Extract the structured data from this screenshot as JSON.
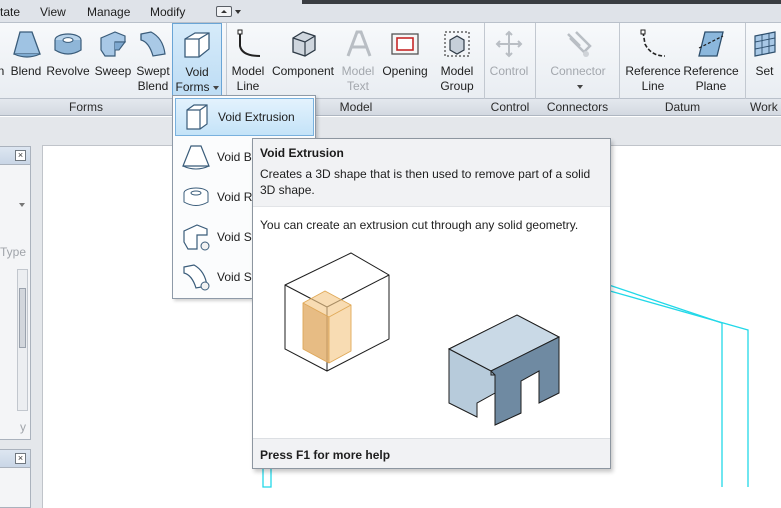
{
  "menubar": {
    "items": [
      "tate",
      "View",
      "Manage",
      "Modify"
    ]
  },
  "ribbon": {
    "buttons": {
      "n": "n",
      "blend": "Blend",
      "revolve": "Revolve",
      "sweep": "Sweep",
      "swept_blend": "Swept\nBlend",
      "void_forms": "Void\nForms",
      "model_line": "Model\nLine",
      "component": "Component",
      "model_text": "Model\nText",
      "opening": "Opening",
      "model_group": "Model\nGroup",
      "control": "Control",
      "connector": "Connector",
      "reference_line": "Reference\nLine",
      "reference_plane": "Reference\nPlane",
      "set": "Set"
    },
    "panels": {
      "forms": "Forms",
      "model": "Model",
      "control": "Control",
      "connectors": "Connectors",
      "datum": "Datum",
      "work": "Work"
    }
  },
  "left_pane": {
    "type_label": "Type",
    "filter_label": "y"
  },
  "dropdown": {
    "items": [
      "Void Extrusion",
      "Void Bl",
      "Void Re",
      "Void Sw",
      "Void Sw"
    ]
  },
  "tooltip": {
    "title": "Void Extrusion",
    "description": "Creates a 3D shape that is then used to remove part of a solid 3D shape.",
    "body": "You can create an extrusion cut through any solid geometry.",
    "footer": "Press F1 for more help"
  },
  "colors": {
    "ribbon_active": "#bcdcf4",
    "drawing_line": "#22d8e8",
    "void_fill": "#f4c98a",
    "solid_fill": "#b9cfe0"
  }
}
